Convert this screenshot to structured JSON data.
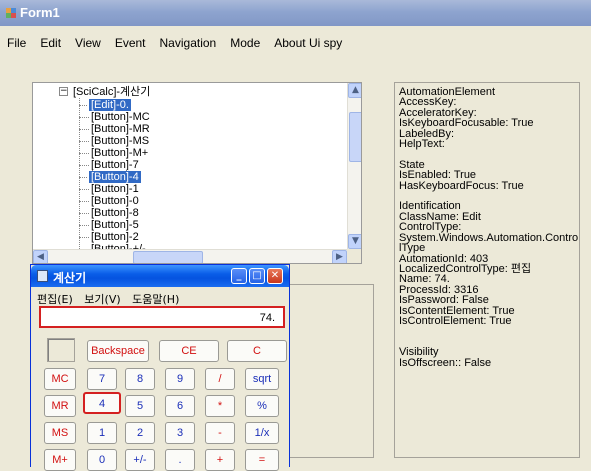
{
  "window": {
    "title": "Form1"
  },
  "menu": [
    "File",
    "Edit",
    "View",
    "Event",
    "Navigation",
    "Mode",
    "About Ui spy"
  ],
  "tree": {
    "root": "[SciCalc]-계산기",
    "rows": [
      {
        "label": "[Edit]-0.",
        "selected": true
      },
      {
        "label": "[Button]-MC",
        "selected": false
      },
      {
        "label": "[Button]-MR",
        "selected": false
      },
      {
        "label": "[Button]-MS",
        "selected": false
      },
      {
        "label": "[Button]-M+",
        "selected": false
      },
      {
        "label": "[Button]-7",
        "selected": false
      },
      {
        "label": "[Button]-4",
        "selected": true
      },
      {
        "label": "[Button]-1",
        "selected": false
      },
      {
        "label": "[Button]-0",
        "selected": false
      },
      {
        "label": "[Button]-8",
        "selected": false
      },
      {
        "label": "[Button]-5",
        "selected": false
      },
      {
        "label": "[Button]-2",
        "selected": false
      },
      {
        "label": "[Button]-+/-",
        "selected": false
      }
    ]
  },
  "properties": "AutomationElement\nAccessKey:\nAcceleratorKey:\nIsKeyboardFocusable: True\nLabeledBy:\nHelpText:\n\nState\nIsEnabled: True\nHasKeyboardFocus: True\n\nIdentification\nClassName: Edit\nControlType:\nSystem.Windows.Automation.Contro\nlType\nAutomationId: 403\nLocalizedControlType: 편집\nName: 74.\nProcessId: 3316\nIsPassword: False\nIsContentElement: True\nIsControlElement: True\n\n\nVisibility\nIsOffscreen:: False",
  "calculator": {
    "title": "계산기",
    "menu": [
      "편집(E)",
      "보기(V)",
      "도움말(H)"
    ],
    "display_value": "74.",
    "top_buttons": [
      "Backspace",
      "CE",
      "C"
    ],
    "memory_buttons": [
      "MC",
      "MR",
      "MS",
      "M+"
    ],
    "grid": [
      [
        "7",
        "8",
        "9",
        "/",
        "sqrt"
      ],
      [
        "4",
        "5",
        "6",
        "*",
        "%"
      ],
      [
        "1",
        "2",
        "3",
        "-",
        "1/x"
      ],
      [
        "0",
        "+/-",
        ".",
        "+",
        "="
      ]
    ],
    "highlighted_button": "4"
  },
  "colors": {
    "selection": "#316ac5",
    "highlight_red": "#d42020",
    "calc_title": "#0a5ee8"
  },
  "icons": [
    "app-icon",
    "expander-minus-icon",
    "scroll-up-icon",
    "scroll-down-icon",
    "scroll-left-icon",
    "scroll-right-icon",
    "calculator-icon",
    "minimize-icon",
    "maximize-icon",
    "close-icon"
  ]
}
